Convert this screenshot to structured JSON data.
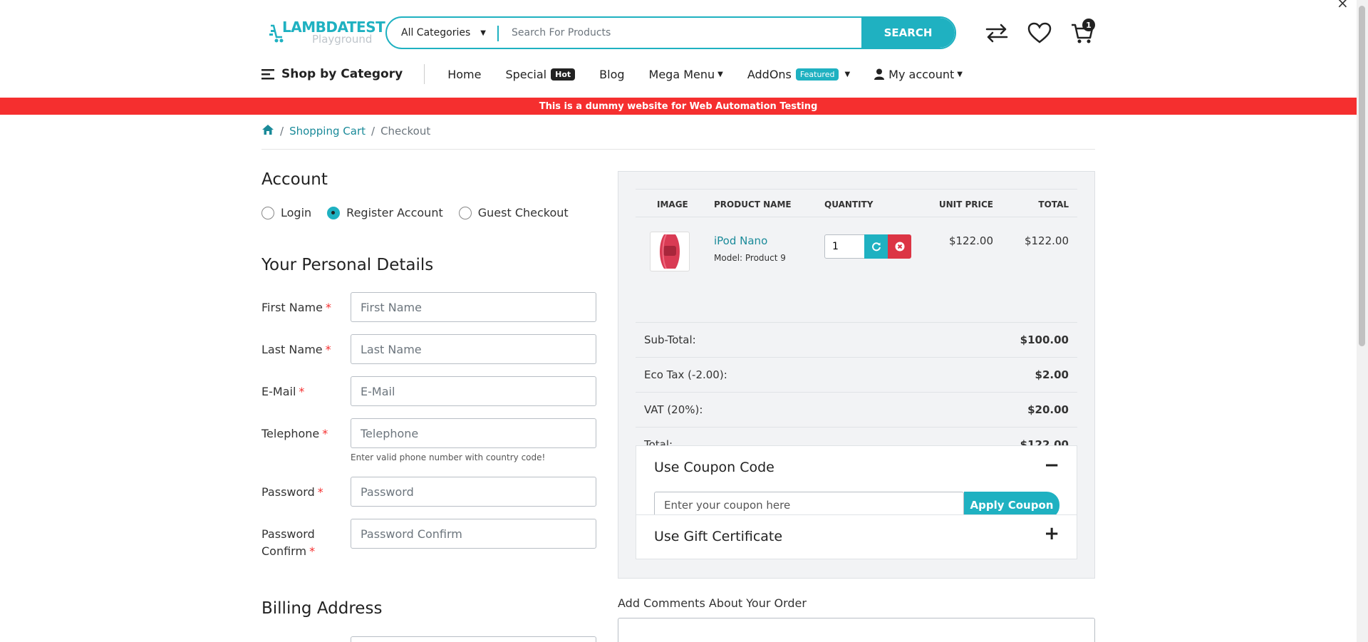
{
  "logo": {
    "brand": "LAMBDATEST",
    "sub": "Playground"
  },
  "search": {
    "category": "All Categories",
    "placeholder": "Search For Products",
    "button": "SEARCH"
  },
  "header": {
    "cart_count": "1"
  },
  "nav": {
    "shop_by_category": "Shop by Category",
    "items": [
      {
        "label": "Home"
      },
      {
        "label": "Special",
        "tag": "Hot"
      },
      {
        "label": "Blog"
      },
      {
        "label": "Mega Menu"
      },
      {
        "label": "AddOns",
        "tag": "Featured"
      },
      {
        "label": "My account"
      }
    ]
  },
  "banner": "This is a dummy website for Web Automation Testing",
  "breadcrumb": {
    "items": [
      "Shopping Cart",
      "Checkout"
    ]
  },
  "account": {
    "title": "Account",
    "options": [
      {
        "label": "Login",
        "selected": false
      },
      {
        "label": "Register Account",
        "selected": true
      },
      {
        "label": "Guest Checkout",
        "selected": false
      }
    ]
  },
  "personal": {
    "title": "Your Personal Details",
    "fields": [
      {
        "label": "First Name",
        "placeholder": "First Name"
      },
      {
        "label": "Last Name",
        "placeholder": "Last Name"
      },
      {
        "label": "E-Mail",
        "placeholder": "E-Mail"
      },
      {
        "label": "Telephone",
        "placeholder": "Telephone"
      },
      {
        "label": "Password",
        "placeholder": "Password"
      },
      {
        "label": "Password Confirm",
        "placeholder": "Password Confirm"
      }
    ],
    "telephone_help": "Enter valid phone number with country code!"
  },
  "billing": {
    "title": "Billing Address"
  },
  "cart": {
    "headers": [
      "IMAGE",
      "PRODUCT NAME",
      "QUANTITY",
      "UNIT PRICE",
      "TOTAL"
    ],
    "items": [
      {
        "name": "iPod Nano",
        "model": "Model: Product 9",
        "quantity": "1",
        "unit_price": "$122.00",
        "total": "$122.00"
      }
    ],
    "totals": [
      {
        "label": "Sub-Total:",
        "value": "$100.00"
      },
      {
        "label": "Eco Tax (-2.00):",
        "value": "$2.00"
      },
      {
        "label": "VAT (20%):",
        "value": "$20.00"
      },
      {
        "label": "Total:",
        "value": "$122.00"
      }
    ]
  },
  "coupon": {
    "title": "Use Coupon Code",
    "toggle": "−",
    "placeholder": "Enter your coupon here",
    "button": "Apply Coupon"
  },
  "gift": {
    "title": "Use Gift Certificate",
    "toggle": "+"
  },
  "comments": {
    "label": "Add Comments About Your Order"
  },
  "colors": {
    "accent": "#1fb1c1",
    "banner": "#f52f2f",
    "link": "#1a8a99",
    "danger": "#dc3545"
  }
}
